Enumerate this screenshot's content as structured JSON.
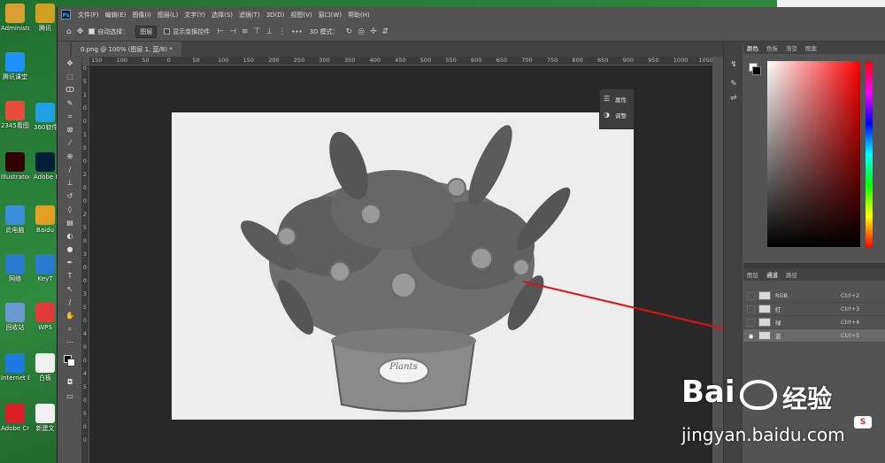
{
  "desktop": {
    "icons": [
      {
        "label": "Administr...",
        "color": "#d8a030"
      },
      {
        "label": "腾讯课堂",
        "color": "#1e90ff"
      },
      {
        "label": "2345看图王",
        "color": "#e84c3d"
      },
      {
        "label": "Illustrator",
        "color": "#330000"
      },
      {
        "label": "此电脑",
        "color": "#3a8fd8"
      },
      {
        "label": "网络",
        "color": "#2a7ad0"
      },
      {
        "label": "回收站",
        "color": "#6a9ad0"
      },
      {
        "label": "Internet Explorer",
        "color": "#1f7ae0"
      },
      {
        "label": "Adobe Creati...",
        "color": "#da1f26"
      }
    ],
    "icons_col2": [
      {
        "label": "腾讯",
        "color": "#d0a020"
      },
      {
        "label": "360软件",
        "color": "#20a0e0"
      },
      {
        "label": "Adobe Photo...",
        "color": "#001e36"
      },
      {
        "label": "Baidu",
        "color": "#e0a020"
      },
      {
        "label": "KeyT",
        "color": "#2a7ad0"
      },
      {
        "label": "WPS",
        "color": "#e03a3a"
      },
      {
        "label": "白板",
        "color": "#f0f0f0"
      },
      {
        "label": "新建文",
        "color": "#f0f0f0"
      }
    ]
  },
  "ps": {
    "logo": "Ps",
    "menu": [
      "文件(F)",
      "编辑(E)",
      "图像(I)",
      "图层(L)",
      "文字(Y)",
      "选择(S)",
      "滤镜(T)",
      "3D(D)",
      "视图(V)",
      "窗口(W)",
      "帮助(H)"
    ],
    "options": {
      "auto_select": "自动选择：",
      "auto_select_value": "图层",
      "show_transform": "显示变换控件",
      "more": "•••",
      "mode_3d": "3D 模式："
    },
    "doc_tab": "0.png @ 100% (图层 1, 蓝/8) *",
    "ruler_h": [
      "150",
      "100",
      "50",
      "0",
      "50",
      "100",
      "150",
      "200",
      "250",
      "300",
      "350",
      "400",
      "450",
      "500",
      "550",
      "600",
      "650",
      "700",
      "750",
      "800",
      "850",
      "900",
      "950",
      "1000",
      "1050"
    ],
    "ruler_v": [
      "0",
      "5",
      "1",
      "0",
      "0",
      "1",
      "5",
      "0",
      "2",
      "0",
      "0",
      "2",
      "5",
      "0",
      "3",
      "0",
      "0",
      "3",
      "5",
      "0",
      "4",
      "0",
      "0",
      "4",
      "5",
      "0",
      "5",
      "0",
      "0"
    ],
    "mini_panel": [
      {
        "icon": "properties-icon",
        "label": "属性"
      },
      {
        "icon": "adjustments-icon",
        "label": "调整"
      }
    ],
    "color_panel_tabs": [
      "颜色",
      "色板",
      "渐变",
      "图案"
    ],
    "channels_tabs": [
      "图层",
      "通道",
      "路径"
    ],
    "channels": [
      {
        "name": "RGB",
        "shortcut": "Ctrl+2",
        "visible": false
      },
      {
        "name": "红",
        "shortcut": "Ctrl+3",
        "visible": false
      },
      {
        "name": "绿",
        "shortcut": "Ctrl+4",
        "visible": false
      },
      {
        "name": "蓝",
        "shortcut": "Ctrl+5",
        "visible": true
      }
    ],
    "photo_caption": "Plants"
  },
  "watermark": {
    "brand": "Bai",
    "brand2": "经验",
    "url": "jingyan.baidu.com",
    "badge": "S"
  }
}
